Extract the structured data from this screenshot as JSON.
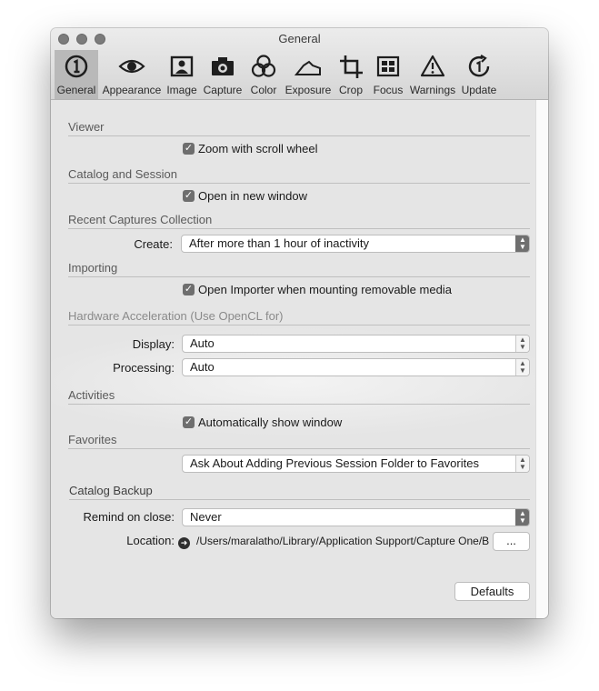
{
  "window": {
    "title": "General"
  },
  "tabs": [
    {
      "label": "General",
      "icon": "info-circle-icon"
    },
    {
      "label": "Appearance",
      "icon": "eye-icon"
    },
    {
      "label": "Image",
      "icon": "image-icon"
    },
    {
      "label": "Capture",
      "icon": "camera-icon"
    },
    {
      "label": "Color",
      "icon": "color-circles-icon"
    },
    {
      "label": "Exposure",
      "icon": "exposure-histogram-icon"
    },
    {
      "label": "Crop",
      "icon": "crop-icon"
    },
    {
      "label": "Focus",
      "icon": "focus-grid-icon"
    },
    {
      "label": "Warnings",
      "icon": "warning-icon"
    },
    {
      "label": "Update",
      "icon": "update-icon"
    }
  ],
  "viewer": {
    "heading": "Viewer",
    "zoom_label": "Zoom with scroll wheel"
  },
  "catalog_session": {
    "heading": "Catalog and Session",
    "open_new_window_label": "Open in new window"
  },
  "recent_captures": {
    "heading": "Recent Captures Collection",
    "create_label": "Create:",
    "create_value": "After more than 1 hour of inactivity"
  },
  "importing": {
    "heading": "Importing",
    "open_importer_label": "Open Importer when mounting removable media"
  },
  "hardware": {
    "heading": "Hardware Acceleration (Use OpenCL for)",
    "display_label": "Display:",
    "display_value": "Auto",
    "processing_label": "Processing:",
    "processing_value": "Auto"
  },
  "activities": {
    "heading": "Activities",
    "auto_show_label": "Automatically show window"
  },
  "favorites": {
    "heading": "Favorites",
    "value": "Ask About Adding Previous Session Folder to Favorites"
  },
  "catalog_backup": {
    "heading": "Catalog Backup",
    "remind_label": "Remind on close:",
    "remind_value": "Never",
    "location_label": "Location:",
    "location_path": "/Users/maralatho/Library/Application Support/Capture One/B",
    "browse_label": "..."
  },
  "defaults_label": "Defaults",
  "colors": {
    "active_tab": "#b9b9b9",
    "checkbox": "#6e6e6e"
  }
}
